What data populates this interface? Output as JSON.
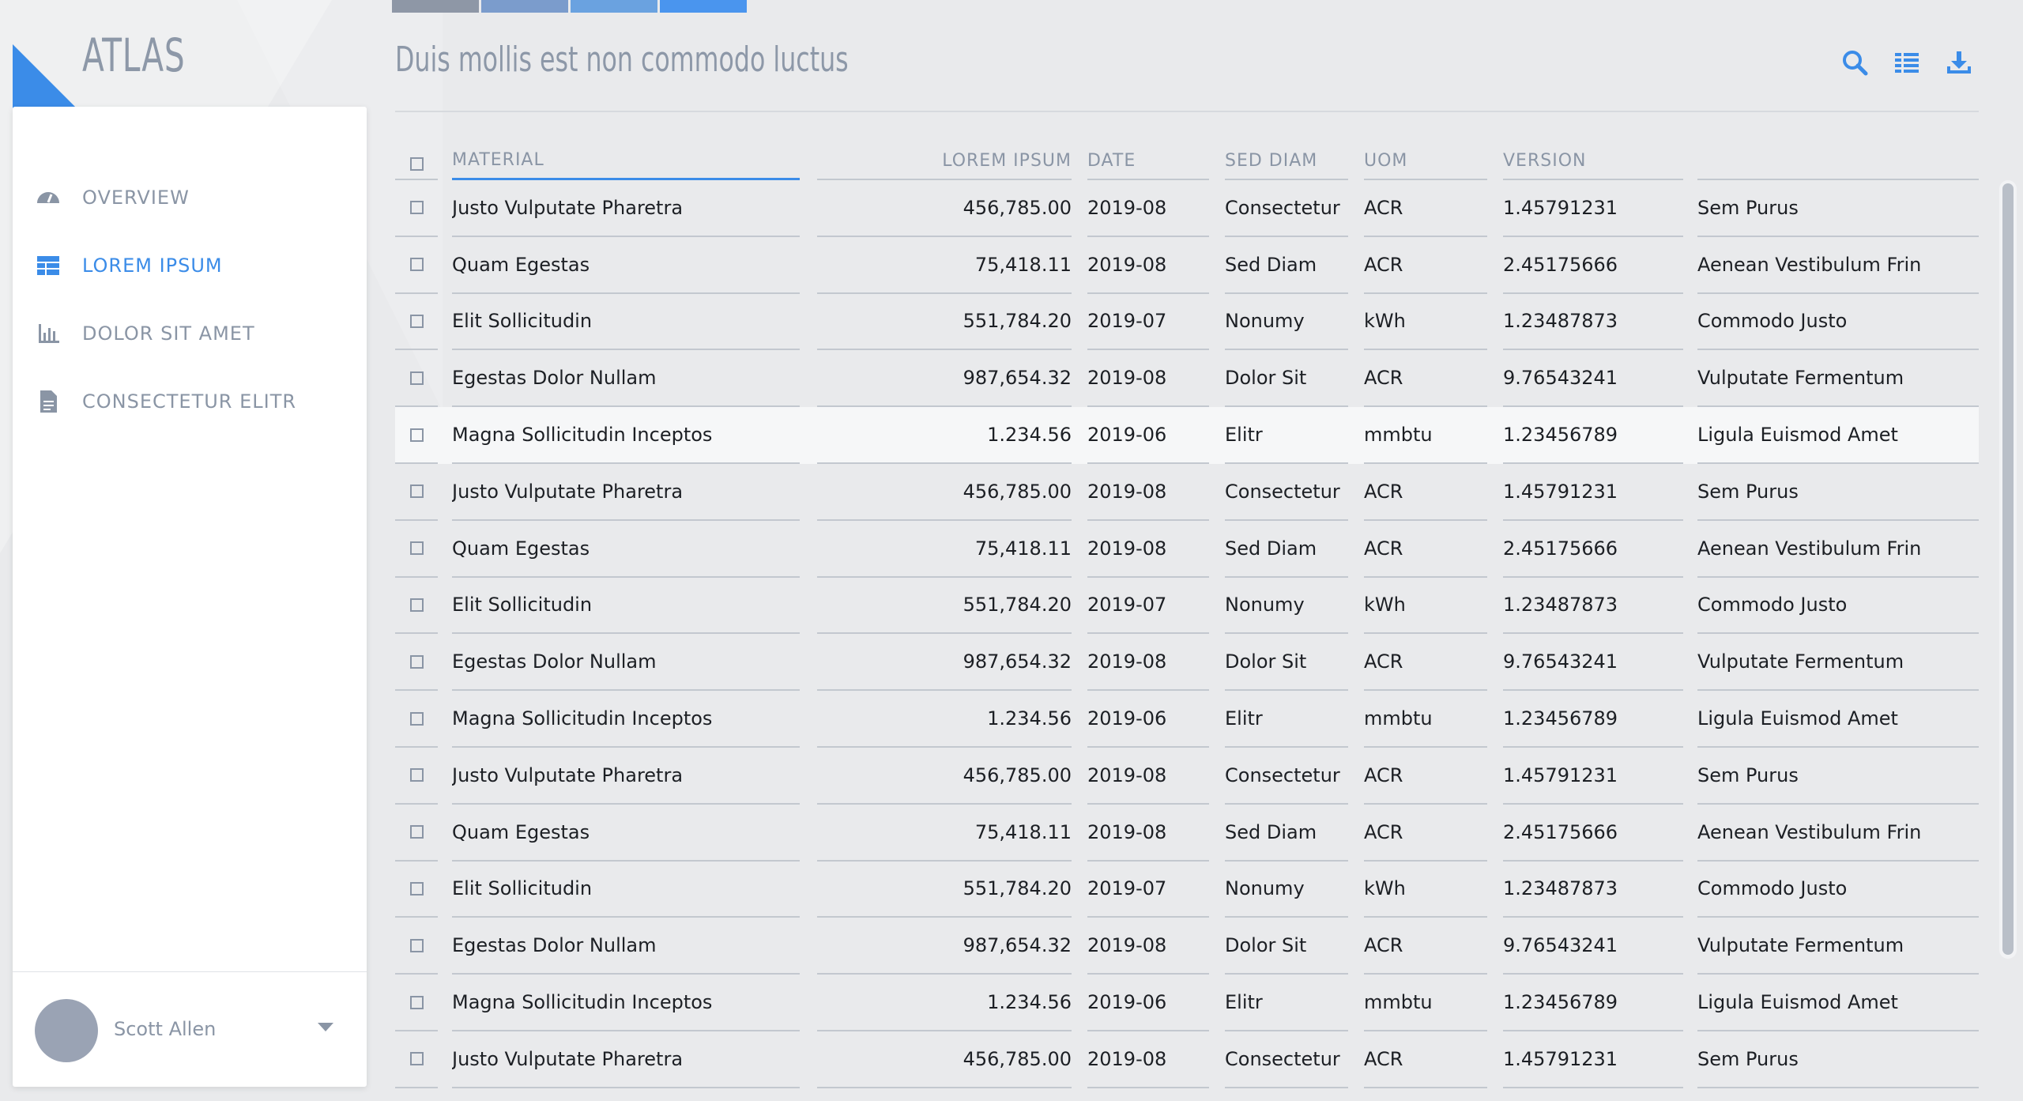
{
  "app": {
    "logo_text": "ATLAS"
  },
  "colors": {
    "accent": "#3b8ce8",
    "muted": "#8a95a5",
    "topbars": [
      "#8e97a6",
      "#7b9ccc",
      "#6aa2e0",
      "#4a95ee"
    ]
  },
  "sidebar": {
    "items": [
      {
        "label": "OVERVIEW",
        "icon": "gauge-icon",
        "active": false
      },
      {
        "label": "LOREM IPSUM",
        "icon": "table-icon",
        "active": true
      },
      {
        "label": "DOLOR SIT AMET",
        "icon": "bar-chart-icon",
        "active": false
      },
      {
        "label": "CONSECTETUR ELITR",
        "icon": "document-icon",
        "active": false
      }
    ],
    "user": {
      "name": "Scott Allen"
    }
  },
  "header": {
    "title": "Duis mollis est non commodo luctus",
    "tools": [
      "search-icon",
      "list-view-icon",
      "download-icon"
    ]
  },
  "table": {
    "columns": [
      "MATERIAL",
      "LOREM IPSUM",
      "DATE",
      "SED DIAM",
      "UOM",
      "VERSION",
      ""
    ],
    "rows": [
      [
        "Justo Vulputate Pharetra",
        "456,785.00",
        "2019-08",
        "Consectetur",
        "ACR",
        "1.45791231",
        "Sem Purus"
      ],
      [
        "Quam Egestas",
        "75,418.11",
        "2019-08",
        "Sed Diam",
        "ACR",
        "2.45175666",
        "Aenean Vestibulum Frin"
      ],
      [
        "Elit Sollicitudin",
        "551,784.20",
        "2019-07",
        "Nonumy",
        "kWh",
        "1.23487873",
        "Commodo Justo"
      ],
      [
        "Egestas Dolor Nullam",
        "987,654.32",
        "2019-08",
        "Dolor Sit",
        "ACR",
        "9.76543241",
        "Vulputate Fermentum"
      ],
      [
        "Magna Sollicitudin Inceptos",
        "1.234.56",
        "2019-06",
        "Elitr",
        "mmbtu",
        "1.23456789",
        "Ligula Euismod Amet"
      ],
      [
        "Justo Vulputate Pharetra",
        "456,785.00",
        "2019-08",
        "Consectetur",
        "ACR",
        "1.45791231",
        "Sem Purus"
      ],
      [
        "Quam Egestas",
        "75,418.11",
        "2019-08",
        "Sed Diam",
        "ACR",
        "2.45175666",
        "Aenean Vestibulum Frin"
      ],
      [
        "Elit Sollicitudin",
        "551,784.20",
        "2019-07",
        "Nonumy",
        "kWh",
        "1.23487873",
        "Commodo Justo"
      ],
      [
        "Egestas Dolor Nullam",
        "987,654.32",
        "2019-08",
        "Dolor Sit",
        "ACR",
        "9.76543241",
        "Vulputate Fermentum"
      ],
      [
        "Magna Sollicitudin Inceptos",
        "1.234.56",
        "2019-06",
        "Elitr",
        "mmbtu",
        "1.23456789",
        "Ligula Euismod Amet"
      ],
      [
        "Justo Vulputate Pharetra",
        "456,785.00",
        "2019-08",
        "Consectetur",
        "ACR",
        "1.45791231",
        "Sem Purus"
      ],
      [
        "Quam Egestas",
        "75,418.11",
        "2019-08",
        "Sed Diam",
        "ACR",
        "2.45175666",
        "Aenean Vestibulum Frin"
      ],
      [
        "Elit Sollicitudin",
        "551,784.20",
        "2019-07",
        "Nonumy",
        "kWh",
        "1.23487873",
        "Commodo Justo"
      ],
      [
        "Egestas Dolor Nullam",
        "987,654.32",
        "2019-08",
        "Dolor Sit",
        "ACR",
        "9.76543241",
        "Vulputate Fermentum"
      ],
      [
        "Magna Sollicitudin Inceptos",
        "1.234.56",
        "2019-06",
        "Elitr",
        "mmbtu",
        "1.23456789",
        "Ligula Euismod Amet"
      ],
      [
        "Justo Vulputate Pharetra",
        "456,785.00",
        "2019-08",
        "Consectetur",
        "ACR",
        "1.45791231",
        "Sem Purus"
      ]
    ],
    "highlighted_row": 4
  }
}
